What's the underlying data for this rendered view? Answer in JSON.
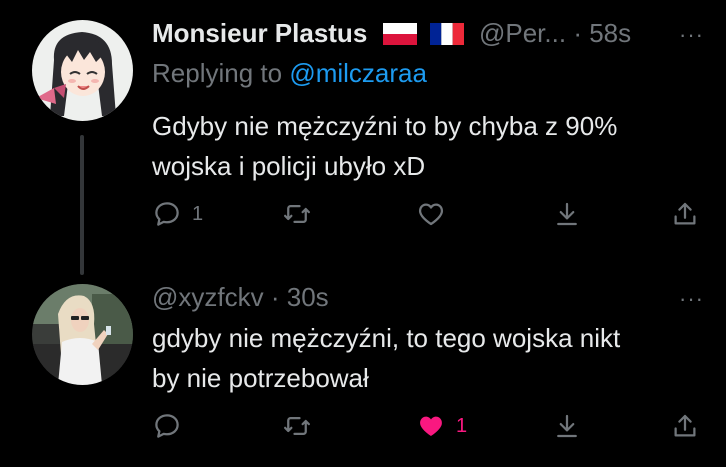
{
  "tweets": [
    {
      "author_name": "Monsieur Plastus",
      "flags": [
        "pl-flag",
        "fr-flag"
      ],
      "handle": "@Per...",
      "separator": "·",
      "time": "58s",
      "more_label": "···",
      "replying_label": "Replying to",
      "replying_handle": "@milczaraa",
      "text_line1": "Gdyby nie mężczyźni to by chyba z 90%",
      "text_line2": "wojska i policji ubyło xD",
      "actions": {
        "reply_count": "1",
        "retweet_count": "",
        "like_count": "",
        "liked": false
      },
      "avatar": "anime-girl-avatar"
    },
    {
      "handle": "@xyzfckv",
      "separator": "·",
      "time": "30s",
      "more_label": "···",
      "text_line1": "gdyby nie mężczyźni, to tego wojska nikt",
      "text_line2": "by nie potrzebował",
      "actions": {
        "reply_count": "",
        "retweet_count": "",
        "like_count": "1",
        "liked": true
      },
      "avatar": "photo-avatar"
    }
  ],
  "colors": {
    "background": "#000000",
    "text": "#e7e9ea",
    "secondary": "#71767b",
    "link": "#1d9bf0",
    "like": "#f91880",
    "thread_line": "#333639"
  }
}
